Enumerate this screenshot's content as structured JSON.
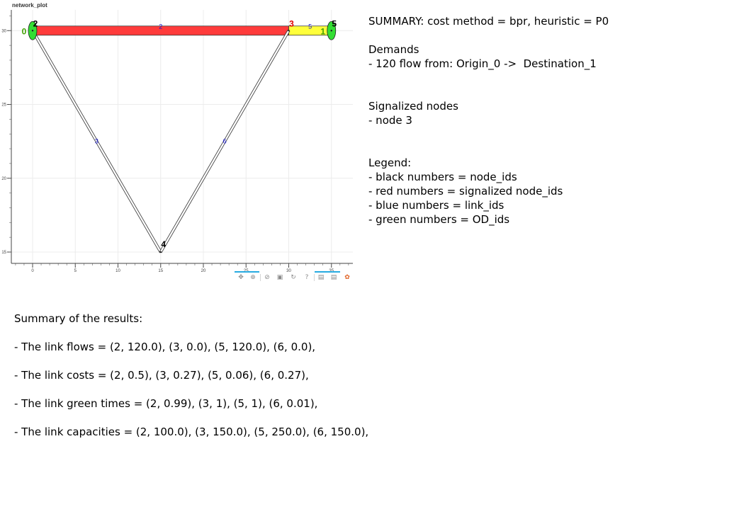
{
  "plot": {
    "title": "network_plot",
    "x_ticks": [
      "0",
      "5",
      "10",
      "15",
      "20",
      "25",
      "30",
      "35"
    ],
    "y_ticks": [
      "30",
      "25",
      "20",
      "15"
    ],
    "nodes": [
      {
        "id": "0",
        "x": 0,
        "y": 30,
        "color": "#000000",
        "kind": "node"
      },
      {
        "id": "2",
        "x": 0,
        "y": 30,
        "color": "#000000",
        "kind": "node"
      },
      {
        "id": "3",
        "x": 30,
        "y": 30,
        "color": "#e00000",
        "kind": "signalized"
      },
      {
        "id": "4",
        "x": 15,
        "y": 15,
        "color": "#000000",
        "kind": "node"
      },
      {
        "id": "5",
        "x": 35,
        "y": 30,
        "color": "#000000",
        "kind": "node"
      },
      {
        "id": "1",
        "x": 35,
        "y": 30,
        "color": "#000000",
        "kind": "node"
      }
    ],
    "links": [
      {
        "id": "2",
        "from": [
          0,
          30
        ],
        "to": [
          30,
          30
        ],
        "color": "#ff3b3b",
        "flow": 120.0
      },
      {
        "id": "5",
        "from": [
          30,
          30
        ],
        "to": [
          35,
          30
        ],
        "color": "#ffff3b",
        "flow": 120.0
      },
      {
        "id": "3",
        "from": [
          0,
          30
        ],
        "to": [
          15,
          15
        ],
        "color": "#ffffff",
        "flow": 0.0
      },
      {
        "id": "6",
        "from": [
          15,
          15
        ],
        "to": [
          30,
          30
        ],
        "color": "#ffffff",
        "flow": 0.0
      }
    ],
    "od_labels": [
      {
        "id": "0",
        "x": 0,
        "y": 30,
        "color": "#3f9f00"
      },
      {
        "id": "1",
        "x": 35,
        "y": 30,
        "color": "#3f9f00"
      }
    ],
    "toolbar": [
      "pan-icon",
      "box-zoom-icon",
      "wheel-zoom-icon",
      "save-icon",
      "reset-icon",
      "help-icon",
      "hover-icon",
      "hover2-icon",
      "bokeh-logo-icon"
    ]
  },
  "summary": {
    "header": "SUMMARY: cost method = bpr, heuristic = P0",
    "demands_title": "Demands",
    "demands": [
      "- 120 flow from: Origin_0 ->  Destination_1"
    ],
    "signalized_title": "Signalized nodes",
    "signalized": [
      "- node 3"
    ],
    "legend_title": "Legend:",
    "legend": [
      "- black numbers = node_ids",
      "- red numbers = signalized node_ids",
      "- blue numbers = link_ids",
      "- green numbers = OD_ids"
    ]
  },
  "results": {
    "title": "Summary of the results:",
    "flows": "- The link flows = (2, 120.0), (3, 0.0), (5, 120.0), (6, 0.0),",
    "costs": "- The link costs = (2, 0.5), (3, 0.27), (5, 0.06), (6, 0.27),",
    "green_times": "- The link green times = (2, 0.99), (3, 1), (5, 1), (6, 0.01),",
    "capacities": "- The link capacities = (2, 100.0), (3, 150.0), (5, 250.0), (6, 150.0),"
  },
  "colors": {
    "signal_red": "#e00000",
    "link_blue": "#1010d0",
    "od_green": "#3f9f00",
    "od_fill": "#33dd33"
  }
}
